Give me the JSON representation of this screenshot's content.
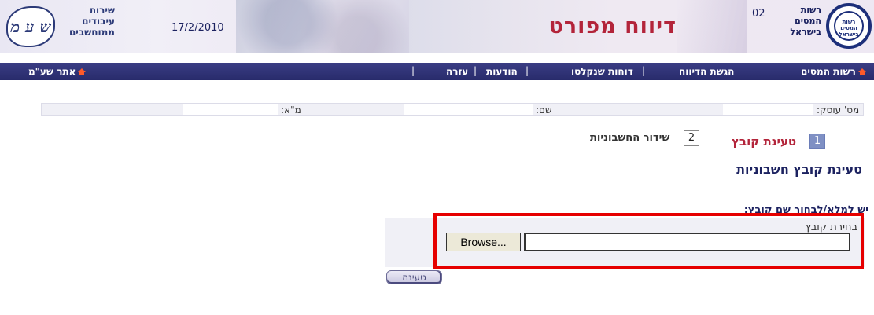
{
  "header": {
    "left_logo_text": [
      "שירות",
      "עיבודים",
      "ממוחשבים"
    ],
    "left_logo_mark": "ש ע מ",
    "date": "17/2/2010",
    "title": "דיווח מפורט",
    "code": "02",
    "tax_authority_text": [
      "רשות",
      "המסים",
      "בישראל"
    ],
    "tax_logo_inner": "רשות המסים בישראל"
  },
  "nav": {
    "tax_authority_link": "רשות המסים",
    "submit_report": "הגשת הדיווח",
    "captured_reports": "דוחות שנקלטו",
    "messages": "הודעות",
    "help": "עזרה",
    "sham_site": "אתר שע\"מ",
    "separator": "|"
  },
  "info": {
    "business_no_label": "מס' עוסק:",
    "name_label": "שם:",
    "vat_label": "מ\"א:"
  },
  "steps": [
    {
      "number": "1",
      "label": "טעינת קובץ"
    },
    {
      "number": "2",
      "label": "שידור החשבוניות"
    }
  ],
  "section_title": "טעינת קובץ חשבוניות",
  "instruction": "יש למלא/לבחור שם קובץ:",
  "upload": {
    "file_label": "בחירת קובץ",
    "browse_label": "Browse...",
    "file_value": ""
  },
  "load_button": "טעינה",
  "colors": {
    "title_red": "#b3243a",
    "nav_blue": "#2f3276",
    "highlight": "#e60000",
    "step_active": "#7f90c4"
  }
}
